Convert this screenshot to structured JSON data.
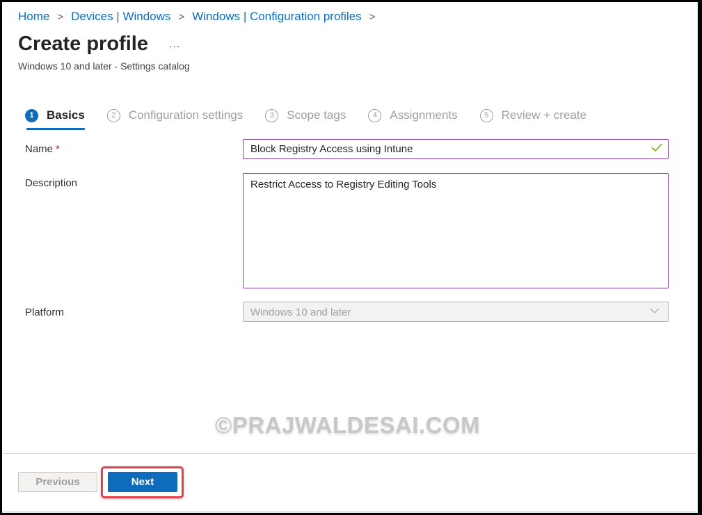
{
  "breadcrumb": [
    {
      "label": "Home"
    },
    {
      "label": "Devices | Windows"
    },
    {
      "label": "Windows | Configuration profiles"
    }
  ],
  "breadcrumb_separator": ">",
  "header": {
    "title": "Create profile",
    "more_label": "...",
    "subtitle": "Windows 10 and later - Settings catalog"
  },
  "steps": [
    {
      "number": "1",
      "label": "Basics",
      "active": true
    },
    {
      "number": "2",
      "label": "Configuration settings",
      "active": false
    },
    {
      "number": "3",
      "label": "Scope tags",
      "active": false
    },
    {
      "number": "4",
      "label": "Assignments",
      "active": false
    },
    {
      "number": "5",
      "label": "Review + create",
      "active": false
    }
  ],
  "form": {
    "name_label": "Name",
    "required_marker": "*",
    "name_value": "Block Registry Access using Intune",
    "name_valid_icon": "checkmark-icon",
    "description_label": "Description",
    "description_value": "Restrict Access to Registry Editing Tools",
    "platform_label": "Platform",
    "platform_value": "Windows 10 and later"
  },
  "watermark": "©PRAJWALDESAI.COM",
  "footer": {
    "previous_label": "Previous",
    "next_label": "Next"
  },
  "colors": {
    "accent": "#0f6cbd",
    "field_border": "#8a3ea8",
    "valid": "#6bb700",
    "required": "#a4262c",
    "highlight": "#e3424b"
  }
}
